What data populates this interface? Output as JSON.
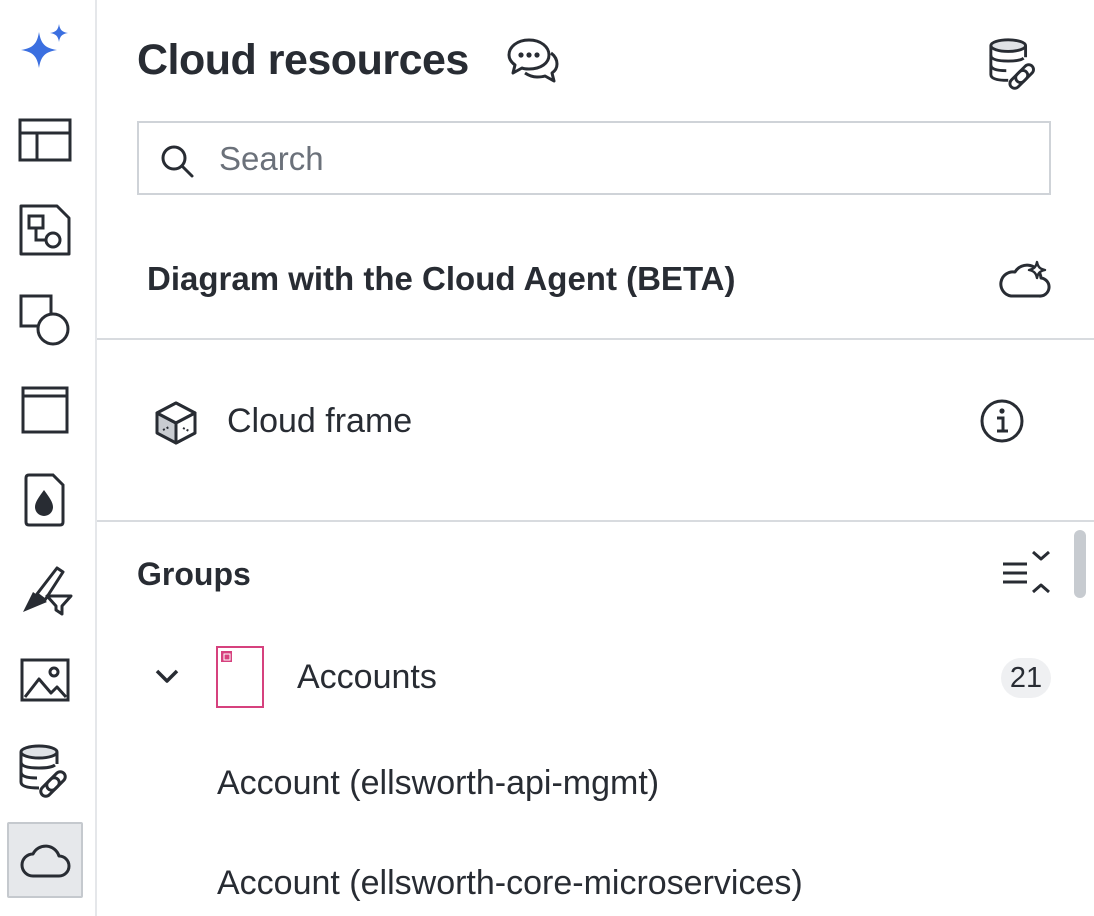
{
  "rail": {
    "items": [
      {
        "name": "ai-sparkle"
      },
      {
        "name": "templates"
      },
      {
        "name": "diagram-shapes"
      },
      {
        "name": "shapes"
      },
      {
        "name": "frame"
      },
      {
        "name": "color-fill"
      },
      {
        "name": "brush-filter"
      },
      {
        "name": "image"
      },
      {
        "name": "data-link"
      },
      {
        "name": "cloud",
        "active": true
      }
    ]
  },
  "panel": {
    "title": "Cloud resources",
    "search": {
      "placeholder": "Search",
      "value": ""
    },
    "agent": {
      "label": "Diagram with the Cloud Agent (BETA)"
    },
    "cloud_frame": {
      "label": "Cloud frame"
    },
    "groups": {
      "title": "Groups",
      "accounts": {
        "label": "Accounts",
        "count": "21",
        "items": [
          "Account (ellsworth-api-mgmt)",
          "Account (ellsworth-core-microservices)"
        ]
      }
    }
  },
  "colors": {
    "accent_blue": "#3b6fe0",
    "account_pink": "#d6417e",
    "text": "#282c33"
  }
}
